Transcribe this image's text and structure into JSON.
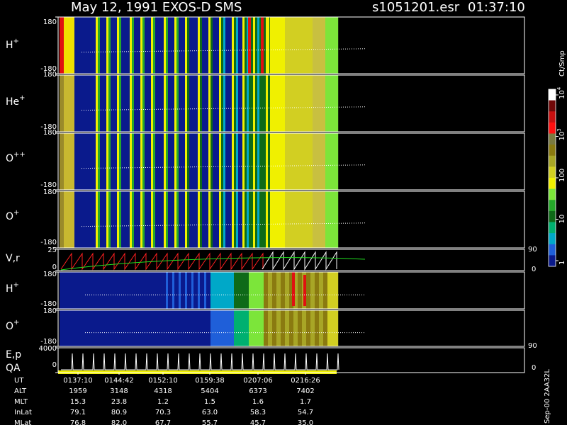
{
  "header": {
    "title": "May 12, 1991   EXOS-D SMS",
    "file": "s1051201.esr",
    "time": "01:37:10"
  },
  "colorbar": {
    "unit": "Ct/Smp",
    "tick_labels": [
      "1",
      "10",
      "100",
      "10",
      "10"
    ],
    "tick_values": [
      1,
      10,
      100,
      1000,
      10000
    ],
    "exponents": [
      "3",
      "4"
    ],
    "colors": [
      "#0a1a8c",
      "#1f5fd9",
      "#00a8c8",
      "#00b070",
      "#0e6a18",
      "#25a82a",
      "#7ce53a",
      "#f0f000",
      "#d2cf22",
      "#a8a626",
      "#8a7a10",
      "#7a7a40",
      "#ff1010",
      "#c81010",
      "#700808",
      "#ffffff"
    ]
  },
  "panels": [
    {
      "id": "h_plus",
      "label": "H",
      "sup": "+",
      "ymax": "180",
      "ymin": "-180"
    },
    {
      "id": "he_plus",
      "label": "He",
      "sup": "+",
      "ymax": "180",
      "ymin": "-180"
    },
    {
      "id": "o_plusplus",
      "label": "O",
      "sup": "++",
      "ymax": "180",
      "ymin": "-180"
    },
    {
      "id": "o_plus",
      "label": "O",
      "sup": "+",
      "ymax": "180",
      "ymin": "-180"
    },
    {
      "id": "vr",
      "label": "V,r",
      "sup": "",
      "ymax": "25",
      "ymin": "0",
      "right_top": "90",
      "right_bottom": "0"
    },
    {
      "id": "h_plus_2",
      "label": "H",
      "sup": "+",
      "ymax": "180",
      "ymin": "-180"
    },
    {
      "id": "o_plus_2",
      "label": "O",
      "sup": "+",
      "ymax": "180",
      "ymin": "-180"
    },
    {
      "id": "ep",
      "label": "E,p",
      "label2": "QA",
      "sup": "",
      "ymax": "4000",
      "ymin": "0",
      "right_top": "90",
      "right_bottom": "0"
    }
  ],
  "chart_data": {
    "type": "heatmap",
    "title": "May 12, 1991   EXOS-D SMS",
    "x_label": "UT",
    "x_ticks": [
      "0137:10",
      "0144:42",
      "0152:10",
      "0159:38",
      "0207:06",
      "0216:26"
    ],
    "ylim_pitch": [
      -180,
      180
    ],
    "ylim_velocity": [
      0,
      25
    ],
    "ylim_energy": [
      0,
      4000
    ],
    "color_scale": "log",
    "color_range": [
      1,
      10000
    ]
  },
  "footer": {
    "rows": [
      {
        "label": "UT",
        "values": [
          "0137:10",
          "0144:42",
          "0152:10",
          "0159:38",
          "0207:06",
          "0216:26"
        ]
      },
      {
        "label": "ALT",
        "values": [
          "1959",
          "3148",
          "4318",
          "5404",
          "6373",
          "7402"
        ]
      },
      {
        "label": "MLT",
        "values": [
          "15.3",
          "23.8",
          "1.2",
          "1.5",
          "1.6",
          "1.7"
        ]
      },
      {
        "label": "InLat",
        "values": [
          "79.1",
          "80.9",
          "70.3",
          "63.0",
          "58.3",
          "54.7"
        ]
      },
      {
        "label": "MLat",
        "values": [
          "76.8",
          "82.0",
          "67.7",
          "55.7",
          "45.7",
          "35.0"
        ]
      }
    ],
    "stamp": "Sep-00  2AA32L"
  }
}
